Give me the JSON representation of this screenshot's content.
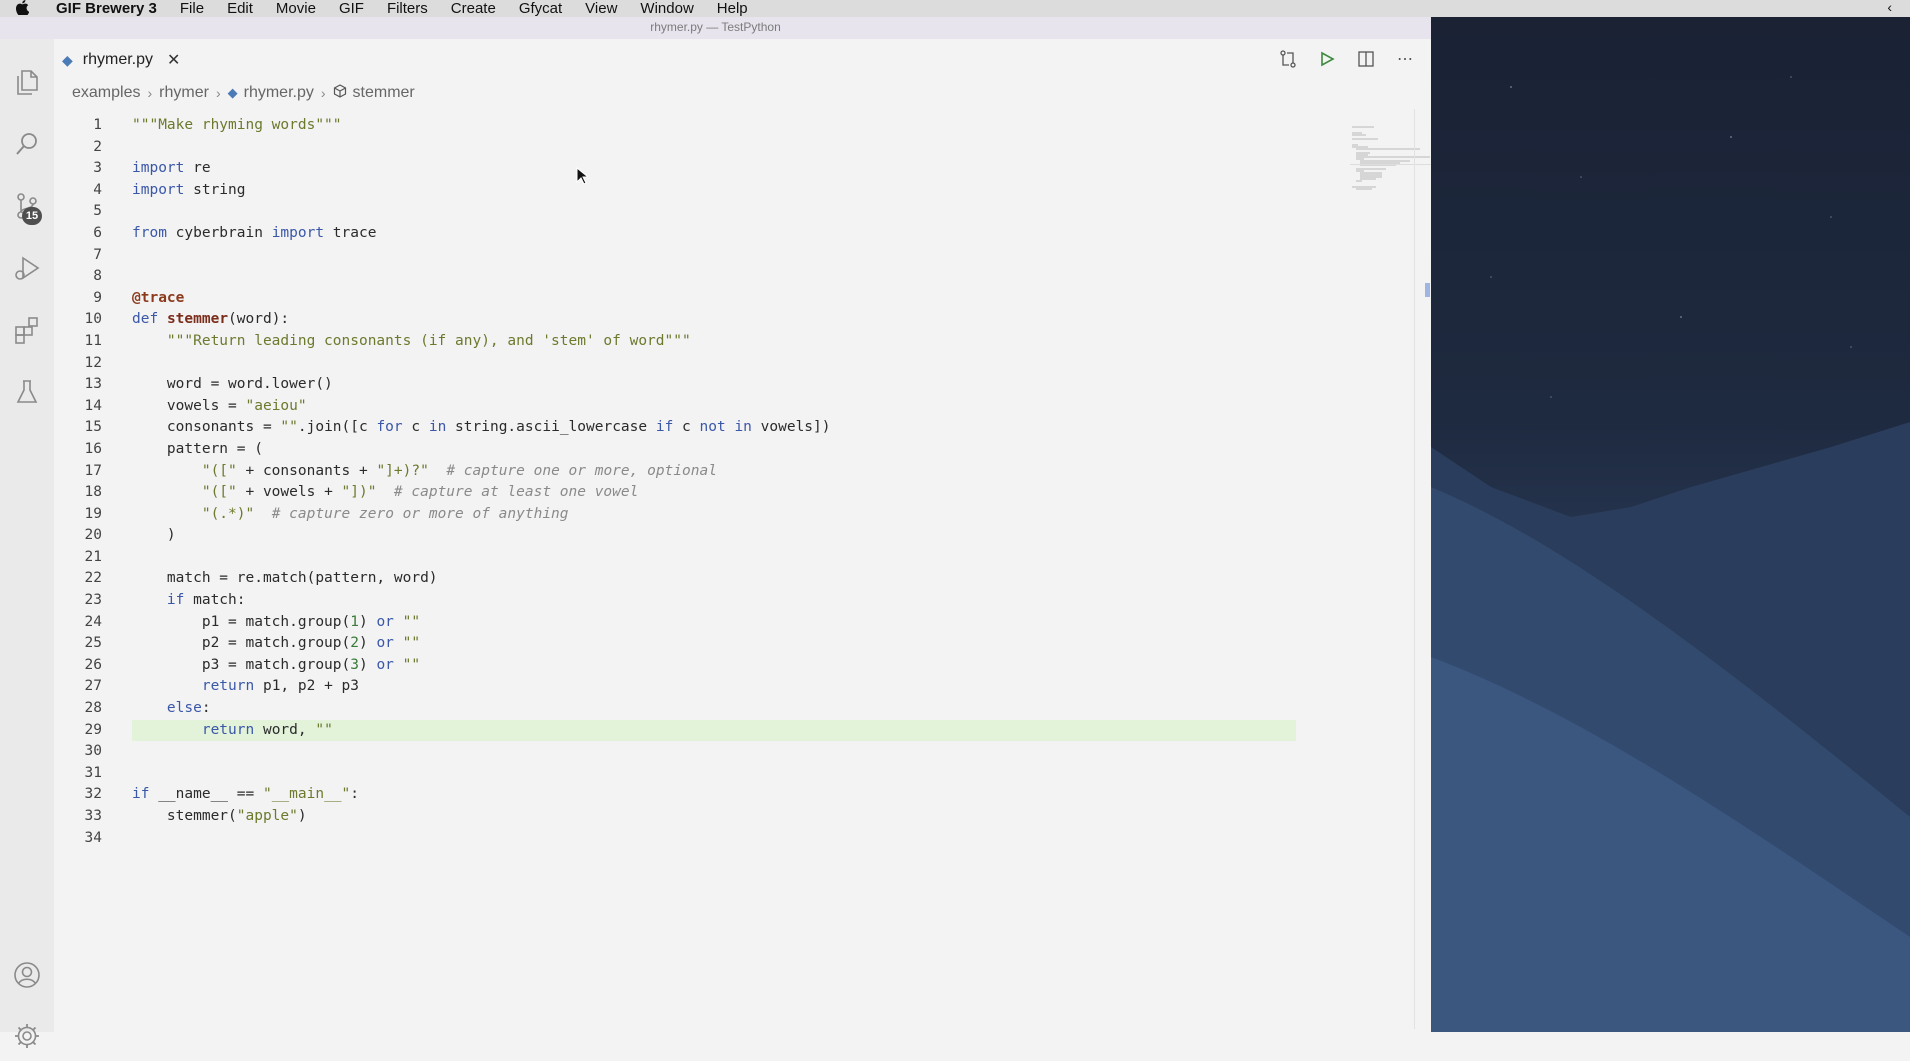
{
  "menubar": {
    "app_name": "GIF Brewery 3",
    "items": [
      "File",
      "Edit",
      "Movie",
      "GIF",
      "Filters",
      "Create",
      "Gfycat",
      "View",
      "Window",
      "Help"
    ]
  },
  "window": {
    "title": "rhymer.py — TestPython"
  },
  "activity_bar": {
    "source_control_badge": "15"
  },
  "tab": {
    "label": "rhymer.py"
  },
  "breadcrumb": {
    "items": [
      "examples",
      "rhymer",
      "rhymer.py",
      "stemmer"
    ]
  },
  "editor": {
    "highlighted_line": 29,
    "lines": [
      {
        "n": "1",
        "t": "\"\"\"Make rhyming words\"\"\""
      },
      {
        "n": "2",
        "t": ""
      },
      {
        "n": "3",
        "t": "import re"
      },
      {
        "n": "4",
        "t": "import string"
      },
      {
        "n": "5",
        "t": ""
      },
      {
        "n": "6",
        "t": "from cyberbrain import trace"
      },
      {
        "n": "7",
        "t": ""
      },
      {
        "n": "8",
        "t": ""
      },
      {
        "n": "9",
        "t": "@trace"
      },
      {
        "n": "10",
        "t": "def stemmer(word):"
      },
      {
        "n": "11",
        "t": "    \"\"\"Return leading consonants (if any), and 'stem' of word\"\"\""
      },
      {
        "n": "12",
        "t": ""
      },
      {
        "n": "13",
        "t": "    word = word.lower()"
      },
      {
        "n": "14",
        "t": "    vowels = \"aeiou\""
      },
      {
        "n": "15",
        "t": "    consonants = \"\".join([c for c in string.ascii_lowercase if c not in vowels])"
      },
      {
        "n": "16",
        "t": "    pattern = ("
      },
      {
        "n": "17",
        "t": "        \"([\" + consonants + \"]+)?\"  # capture one or more, optional"
      },
      {
        "n": "18",
        "t": "        \"([\" + vowels + \"])\"  # capture at least one vowel"
      },
      {
        "n": "19",
        "t": "        \"(.*)\"  # capture zero or more of anything"
      },
      {
        "n": "20",
        "t": "    )"
      },
      {
        "n": "21",
        "t": ""
      },
      {
        "n": "22",
        "t": "    match = re.match(pattern, word)"
      },
      {
        "n": "23",
        "t": "    if match:"
      },
      {
        "n": "24",
        "t": "        p1 = match.group(1) or \"\""
      },
      {
        "n": "25",
        "t": "        p2 = match.group(2) or \"\""
      },
      {
        "n": "26",
        "t": "        p3 = match.group(3) or \"\""
      },
      {
        "n": "27",
        "t": "        return p1, p2 + p3"
      },
      {
        "n": "28",
        "t": "    else:"
      },
      {
        "n": "29",
        "t": "        return word, \"\""
      },
      {
        "n": "30",
        "t": ""
      },
      {
        "n": "31",
        "t": ""
      },
      {
        "n": "32",
        "t": "if __name__ == \"__main__\":"
      },
      {
        "n": "33",
        "t": "    stemmer(\"apple\")"
      },
      {
        "n": "34",
        "t": ""
      }
    ]
  },
  "colors": {
    "highlight": "#e2f3da",
    "keyword": "#3a57a8",
    "string": "#6b7a2d"
  }
}
